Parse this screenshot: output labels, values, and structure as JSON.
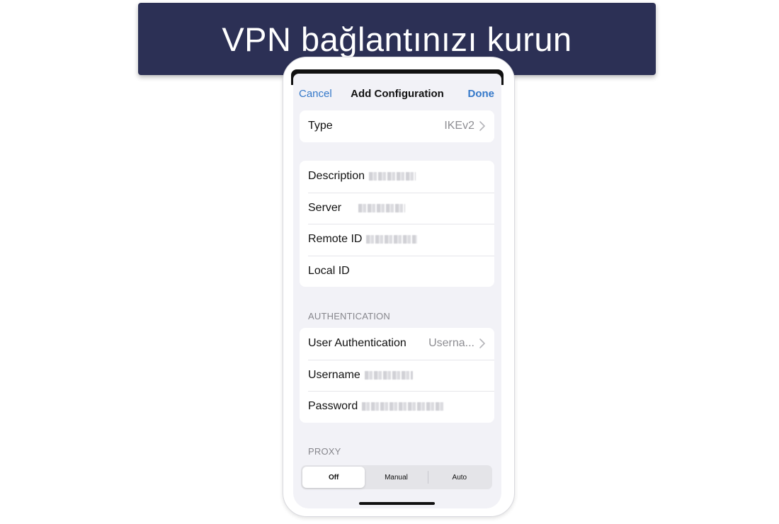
{
  "banner": {
    "title": "VPN bağlantınızı kurun"
  },
  "nav": {
    "cancel": "Cancel",
    "title": "Add Configuration",
    "done": "Done"
  },
  "type_row": {
    "label": "Type",
    "value": "IKEv2"
  },
  "connection_rows": {
    "description": {
      "label": "Description"
    },
    "server": {
      "label": "Server"
    },
    "remote_id": {
      "label": "Remote ID"
    },
    "local_id": {
      "label": "Local ID"
    }
  },
  "authentication": {
    "header": "AUTHENTICATION",
    "user_auth": {
      "label": "User Authentication",
      "value": "Userna..."
    },
    "username": {
      "label": "Username"
    },
    "password": {
      "label": "Password"
    }
  },
  "proxy": {
    "header": "PROXY",
    "options": [
      "Off",
      "Manual",
      "Auto"
    ],
    "selected": "Off"
  },
  "colors": {
    "banner_bg": "#2c3055",
    "accent": "#3478c9",
    "screen_bg": "#f2f2f7"
  }
}
